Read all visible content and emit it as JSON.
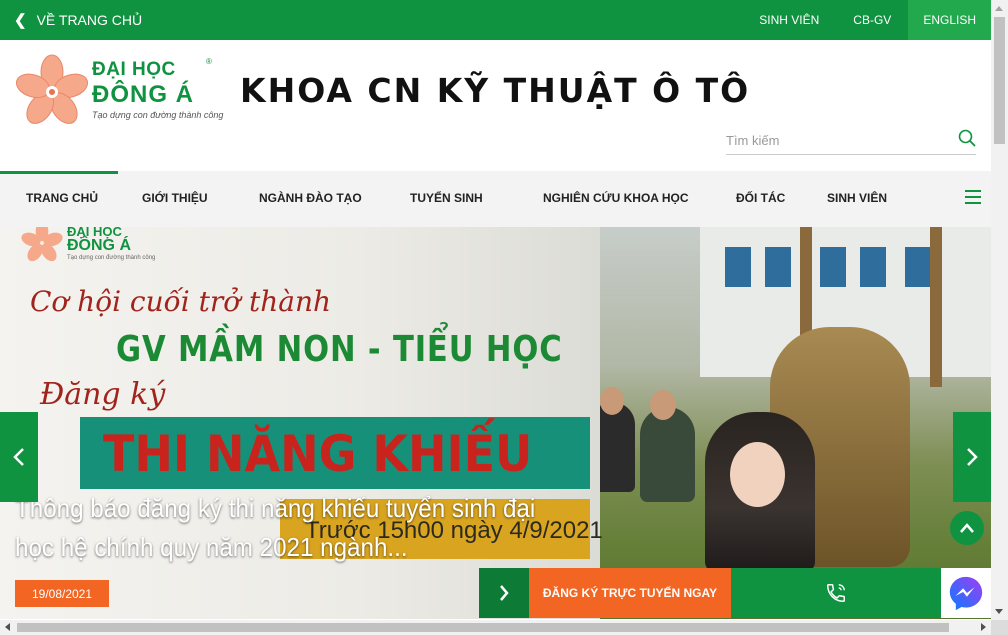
{
  "topbar": {
    "back_label": "VỀ TRANG CHỦ",
    "links": [
      "SINH VIÊN",
      "CB-GV"
    ],
    "language": "ENGLISH"
  },
  "header": {
    "logo_line1": "ĐẠI HỌC",
    "logo_line2": "ĐÔNG Á",
    "logo_tagline": "Tạo dựng con đường thành công",
    "logo_reg": "®",
    "site_title": "KHOA CN KỸ THUẬT Ô TÔ",
    "search_placeholder": "Tìm kiếm"
  },
  "nav": {
    "items": [
      "TRANG CHỦ",
      "GIỚI THIỆU",
      "NGÀNH ĐÀO TẠO",
      "TUYỂN SINH",
      "NGHIÊN CỨU KHOA HỌC",
      "ĐỐI TÁC",
      "SINH VIÊN"
    ],
    "active_index": 0
  },
  "slide": {
    "poster_logo_line1": "ĐẠI HỌC",
    "poster_logo_line2": "ĐÔNG Á",
    "poster_logo_tagline": "Tạo dựng con đường thành công",
    "poster_line1": "Cơ hội cuối trở thành",
    "poster_line2": "GV MẦM NON - TIỂU HỌC",
    "poster_line3": "Đăng ký",
    "poster_band": "THI NĂNG KHIẾU",
    "poster_date": "Trước 15h00 ngày 4/9/2021",
    "caption": "Thông báo đăng ký thi năng khiếu tuyển sinh đại học hệ chính quy năm 2021 ngành...",
    "date": "19/08/2021"
  },
  "cta": {
    "register_label": "ĐĂNG KÝ TRỰC TUYẾN NGAY"
  },
  "colors": {
    "brand_green": "#109340",
    "accent_orange": "#f26522"
  },
  "icons": [
    "chevron-left-icon",
    "search-icon",
    "hamburger-icon",
    "chevron-right-icon",
    "phone-icon",
    "arrow-up-icon",
    "messenger-icon"
  ]
}
